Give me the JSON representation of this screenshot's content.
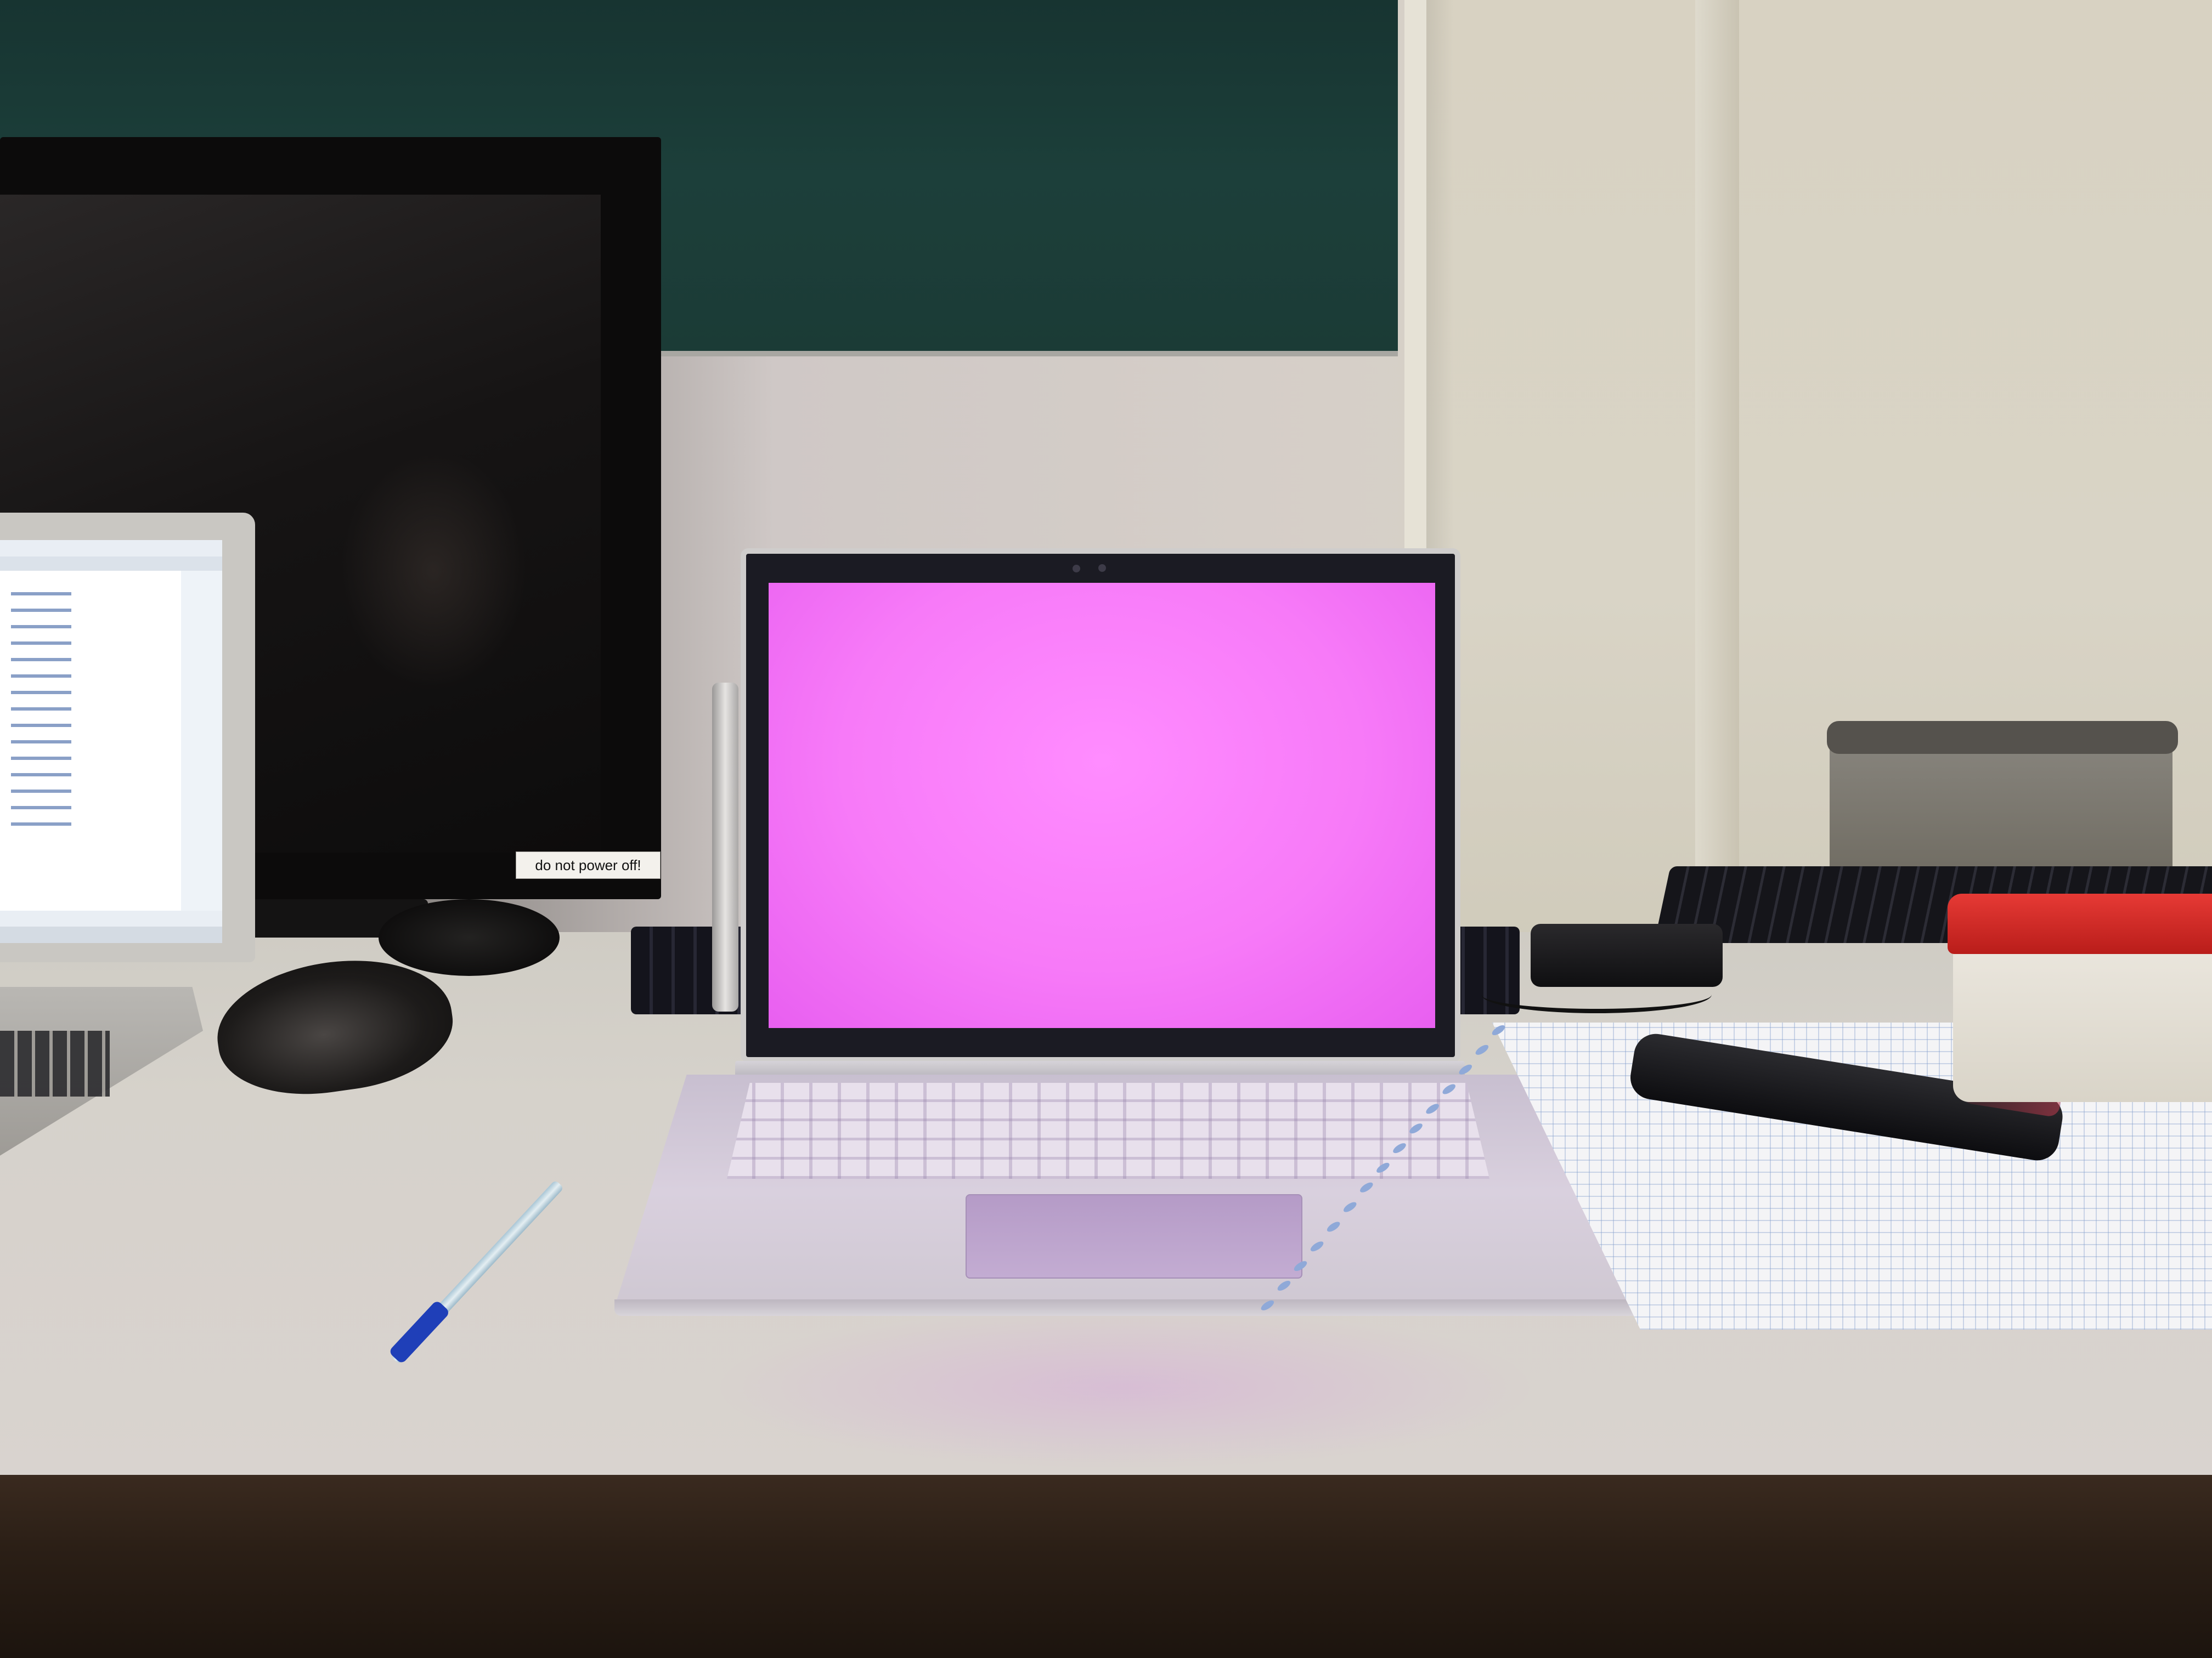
{
  "scene": {
    "sticker_text": "do not power off!",
    "main_screen_color": "#f77af8"
  }
}
